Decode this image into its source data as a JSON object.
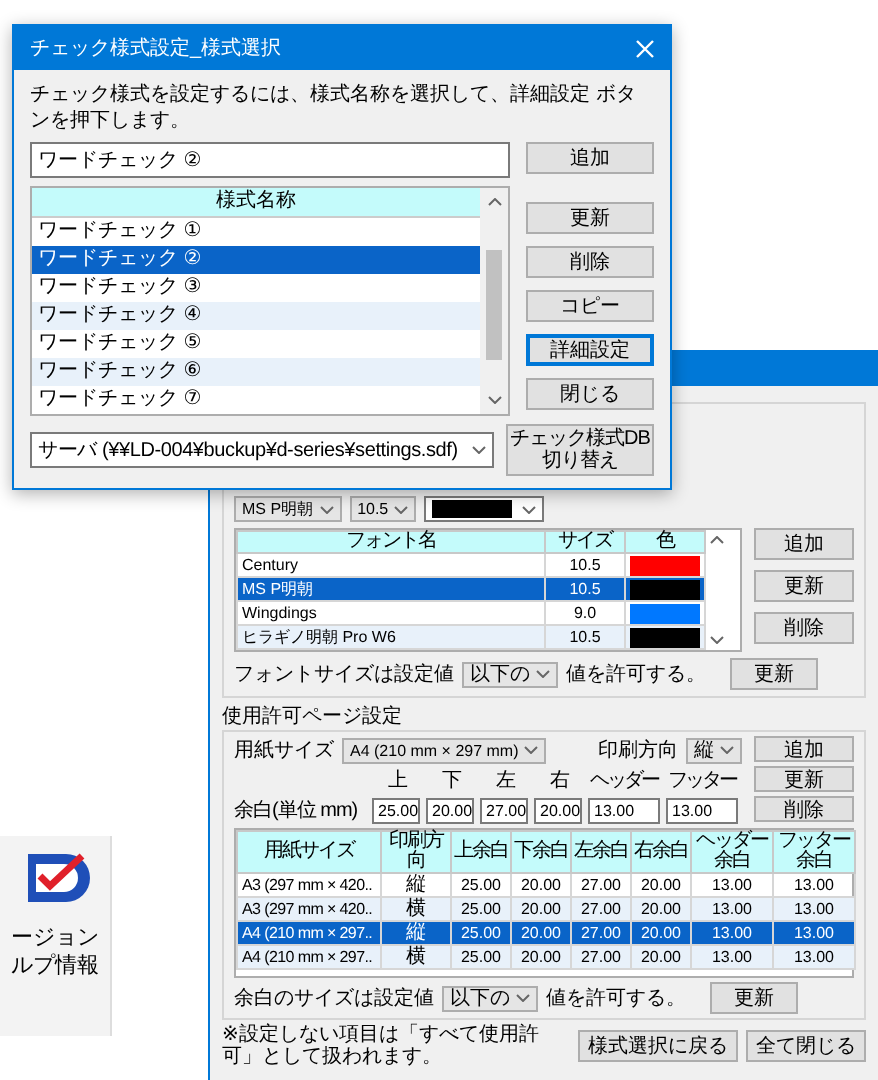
{
  "side_panel": {
    "lines": [
      "ージョン",
      "ルプ情報"
    ]
  },
  "back_window": {
    "font_group": {
      "font_select": "MS P明朝",
      "size_select": "10.5",
      "columns": [
        "フォント名",
        "サイズ",
        "色"
      ],
      "rows": [
        {
          "font": "Century",
          "size": "10.5",
          "color": "#ff0000",
          "selected": false
        },
        {
          "font": "MS P明朝",
          "size": "10.5",
          "color": "#000000",
          "selected": true
        },
        {
          "font": "Wingdings",
          "size": "9.0",
          "color": "#0078ff",
          "selected": false
        },
        {
          "font": "ヒラギノ明朝 Pro W6",
          "size": "10.5",
          "color": "#000000",
          "selected": false
        }
      ],
      "buttons": [
        "追加",
        "更新",
        "削除"
      ],
      "limit_prefix": "フォントサイズは設定値",
      "limit_select": "以下の",
      "limit_suffix": "値を許可する。",
      "update_button": "更新"
    },
    "page_group": {
      "title": "使用許可ページ設定",
      "paper_label": "用紙サイズ",
      "paper_select": "A4 (210 mm × 297 mm)",
      "orientation_label": "印刷方向",
      "orientation_select": "縦",
      "buttons": [
        "追加",
        "更新",
        "削除"
      ],
      "margin_label": "余白(単位 mm)",
      "margins": [
        {
          "label": "上",
          "value": "25.00"
        },
        {
          "label": "下",
          "value": "20.00"
        },
        {
          "label": "左",
          "value": "27.00"
        },
        {
          "label": "右",
          "value": "20.00"
        },
        {
          "label": "ヘッダー",
          "value": "13.00"
        },
        {
          "label": "フッター",
          "value": "13.00"
        }
      ],
      "columns": [
        "用紙サイズ",
        "印刷方向",
        "上余白",
        "下余白",
        "左余白",
        "右余白",
        "ヘッダー余白",
        "フッター余白"
      ],
      "rows": [
        {
          "cells": [
            "A3 (297 mm × 420..",
            "縦",
            "25.00",
            "20.00",
            "27.00",
            "20.00",
            "13.00",
            "13.00"
          ],
          "selected": false
        },
        {
          "cells": [
            "A3 (297 mm × 420..",
            "横",
            "25.00",
            "20.00",
            "27.00",
            "20.00",
            "13.00",
            "13.00"
          ],
          "selected": false
        },
        {
          "cells": [
            "A4 (210 mm × 297..",
            "縦",
            "25.00",
            "20.00",
            "27.00",
            "20.00",
            "13.00",
            "13.00"
          ],
          "selected": true
        },
        {
          "cells": [
            "A4 (210 mm × 297..",
            "横",
            "25.00",
            "20.00",
            "27.00",
            "20.00",
            "13.00",
            "13.00"
          ],
          "selected": false
        }
      ],
      "limit_prefix": "余白のサイズは設定値",
      "limit_select": "以下の",
      "limit_suffix": "値を許可する。",
      "update_button": "更新"
    },
    "note": "※設定しない項目は「すべて使用許可」として扱われます。",
    "footer_buttons": [
      "様式選択に戻る",
      "全て閉じる"
    ]
  },
  "dialog": {
    "title": "チェック様式設定_様式選択",
    "instruction": "チェック様式を設定するには、様式名称を選択して、詳細設定 ボタンを押下します。",
    "name_value": "ワードチェック ②",
    "list_header": "様式名称",
    "items": [
      {
        "label": "ワードチェック ①",
        "selected": false
      },
      {
        "label": "ワードチェック ②",
        "selected": true
      },
      {
        "label": "ワードチェック ③",
        "selected": false
      },
      {
        "label": "ワードチェック ④",
        "selected": false
      },
      {
        "label": "ワードチェック ⑤",
        "selected": false
      },
      {
        "label": "ワードチェック ⑥",
        "selected": false
      },
      {
        "label": "ワードチェック ⑦",
        "selected": false
      }
    ],
    "buttons": [
      {
        "label": "追加",
        "focused": false
      },
      {
        "label": "更新",
        "focused": false
      },
      {
        "label": "削除",
        "focused": false
      },
      {
        "label": "コピー",
        "focused": false
      },
      {
        "label": "詳細設定",
        "focused": true
      },
      {
        "label": "閉じる",
        "focused": false
      }
    ],
    "db_button": [
      "チェック様式DB",
      "切り替え"
    ],
    "db_select": "サーバ (¥¥LD-004¥buckup¥d-series¥settings.sdf)"
  }
}
